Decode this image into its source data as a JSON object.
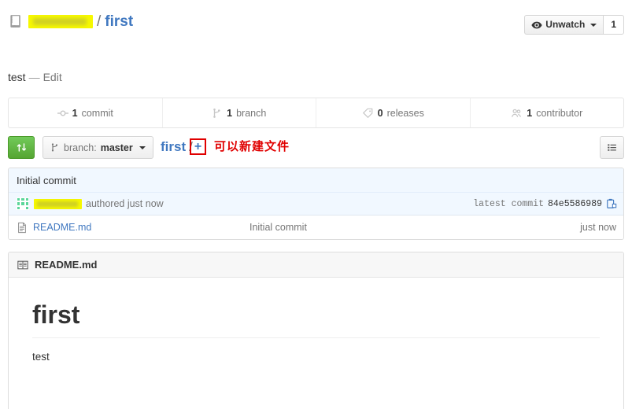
{
  "header": {
    "repo_icon": "repo-book-icon",
    "owner_redacted": "",
    "separator": "/",
    "repo_name": "first",
    "watch_label": "Unwatch",
    "watch_icon": "eye-icon",
    "watch_count": "1"
  },
  "description": {
    "text": "test",
    "dash": "—",
    "edit_label": "Edit"
  },
  "stats": [
    {
      "icon": "commit-icon",
      "count": "1",
      "label": "commit"
    },
    {
      "icon": "branch-icon",
      "count": "1",
      "label": "branch"
    },
    {
      "icon": "tag-icon",
      "count": "0",
      "label": "releases"
    },
    {
      "icon": "people-icon",
      "count": "1",
      "label": "contributor"
    }
  ],
  "toolbar": {
    "compare_icon": "compare-arrows-icon",
    "branch_icon": "branch-icon",
    "branch_prefix": "branch:",
    "branch_name": "master",
    "breadcrumb_repo": "first",
    "breadcrumb_sep": "/",
    "add_file_label": "+",
    "list_icon": "list-view-icon",
    "annotation": "可以新建文件",
    "annotation_color": "#e00000",
    "highlight_box_color": "#e00000"
  },
  "commit": {
    "title": "Initial commit",
    "avatar_icon": "identicon-avatar",
    "author_redacted": "",
    "authored_text": "authored just now",
    "latest_commit_label": "latest commit",
    "sha": "84e5586989",
    "copy_icon": "clipboard-copy-icon"
  },
  "files": [
    {
      "icon": "file-text-icon",
      "name": "README.md",
      "message": "Initial commit",
      "time": "just now"
    }
  ],
  "readme": {
    "icon": "book-icon",
    "title": "README.md",
    "heading": "first",
    "body": "test"
  }
}
